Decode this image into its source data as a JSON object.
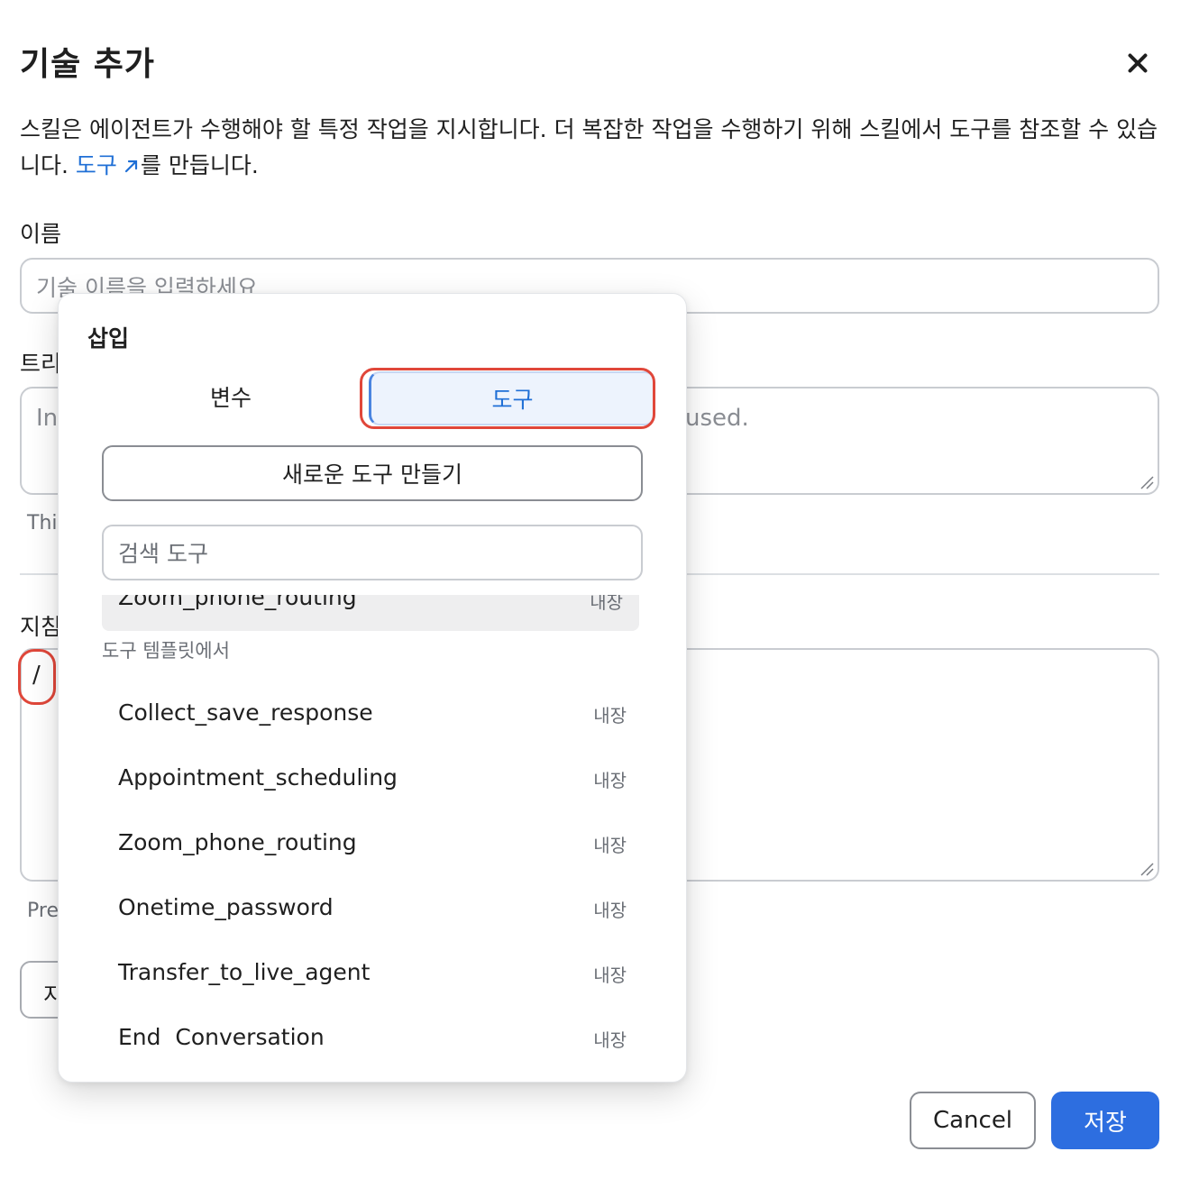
{
  "dialog": {
    "title": "기술 추가",
    "description_text": "스킬은 에이전트가 수행해야 할 특정 작업을 지시합니다. 더 복잡한 작업을 수행하기 위해 스킬에서 도구를 참조할 수 있습니다. ",
    "description_link": "도구",
    "description_suffix": "를 만듭니다.",
    "name_label": "이름",
    "name_placeholder": "기술 이름을 입력하세요",
    "trigger_label_partial": "트리",
    "trigger_text_partial_left": "In",
    "trigger_text_partial_right": "used.",
    "trigger_help_partial": "Thi",
    "instructions_label_partial": "지침",
    "instructions_value": "/",
    "instructions_help_partial": "Pre",
    "partial_button_label": "지",
    "cancel_label": "Cancel",
    "save_label": "저장"
  },
  "popup": {
    "title": "삽입",
    "tabs": [
      {
        "label": "변수",
        "selected": false
      },
      {
        "label": "도구",
        "selected": true
      }
    ],
    "create_tool_label": "새로운 도구 만들기",
    "search_placeholder": "검색 도구",
    "scrolled_item": {
      "name": "Zoom_phone_routing",
      "tag": "내장"
    },
    "section_label": "도구 템플릿에서",
    "tools": [
      {
        "name": "Collect_save_response",
        "tag": "내장"
      },
      {
        "name": "Appointment_scheduling",
        "tag": "내장"
      },
      {
        "name": "Zoom_phone_routing",
        "tag": "내장"
      },
      {
        "name": "Onetime_password",
        "tag": "내장"
      },
      {
        "name": "Transfer_to_live_agent",
        "tag": "내장"
      },
      {
        "name": "End  Conversation",
        "tag": "내장"
      }
    ]
  },
  "colors": {
    "link": "#1f6fd6",
    "primary_button": "#2d6ee0",
    "highlight": "#e0473a",
    "selected_tab_bg": "#edf3fd"
  }
}
